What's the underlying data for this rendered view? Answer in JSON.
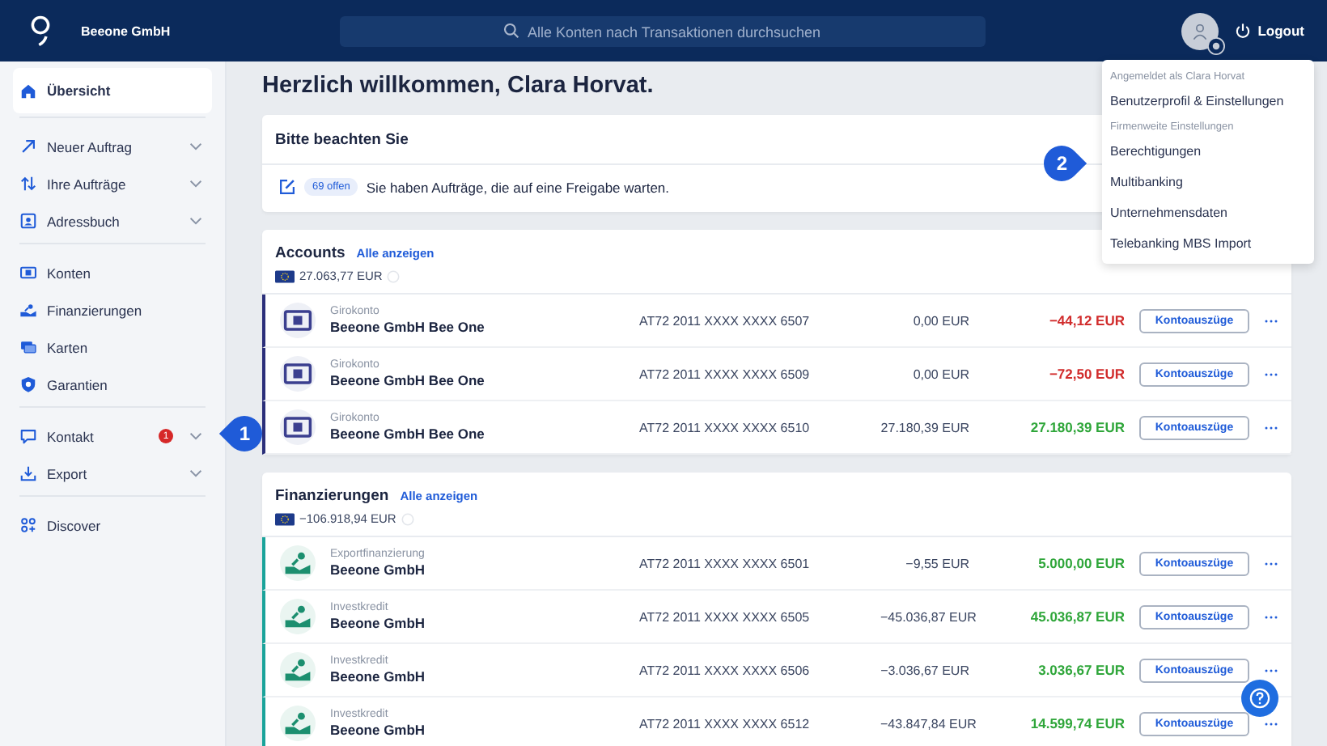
{
  "header": {
    "company": "Beeone GmbH",
    "search": {
      "placeholder": "Alle Konten nach Transaktionen durchsuchen"
    },
    "logout": "Logout"
  },
  "user_menu": [
    {
      "kind": "label",
      "text": "Angemeldet als Clara Horvat"
    },
    {
      "kind": "item",
      "text": "Benutzerprofil & Einstellungen"
    },
    {
      "kind": "label",
      "text": "Firmenweite Einstellungen"
    },
    {
      "kind": "item",
      "text": "Berechtigungen"
    },
    {
      "kind": "item",
      "text": "Multibanking"
    },
    {
      "kind": "item",
      "text": "Unternehmensdaten"
    },
    {
      "kind": "item",
      "text": "Telebanking MBS Import"
    }
  ],
  "sidebar": {
    "groups": [
      [
        {
          "label": "Übersicht",
          "selected": true,
          "expandable": false
        }
      ],
      [
        {
          "label": "Neuer Auftrag",
          "selected": false,
          "expandable": true
        },
        {
          "label": "Ihre Aufträge",
          "selected": false,
          "expandable": true
        },
        {
          "label": "Adressbuch",
          "selected": false,
          "expandable": true
        }
      ],
      [
        {
          "label": "Konten",
          "selected": false,
          "expandable": false
        },
        {
          "label": "Finanzierungen",
          "selected": false,
          "expandable": false
        },
        {
          "label": "Karten",
          "selected": false,
          "expandable": false
        },
        {
          "label": "Garantien",
          "selected": false,
          "expandable": false
        }
      ],
      [
        {
          "label": "Kontakt",
          "selected": false,
          "expandable": true,
          "badge": "1"
        },
        {
          "label": "Export",
          "selected": false,
          "expandable": true
        }
      ],
      [
        {
          "label": "Discover",
          "selected": false,
          "expandable": false
        }
      ]
    ]
  },
  "greeting": "Herzlich willkommen, Clara Horvat.",
  "notice": {
    "title": "Bitte beachten Sie",
    "badge": "69 offen",
    "text": "Sie haben Aufträge, die auf eine Freigabe warten."
  },
  "sections": [
    {
      "kind": "accounts",
      "title": "Accounts",
      "link": "Alle anzeigen",
      "total": "27.063,77 EUR",
      "rows": [
        {
          "type": "Girokonto",
          "name": "Beeone GmbH Bee One",
          "iban": "AT72 2011 XXXX XXXX 6507",
          "balance": "0,00 EUR",
          "available": "−44,12 EUR",
          "overdrawn": true,
          "button": "Kontoauszüge"
        },
        {
          "type": "Girokonto",
          "name": "Beeone GmbH Bee One",
          "iban": "AT72 2011 XXXX XXXX 6509",
          "balance": "0,00 EUR",
          "available": "−72,50 EUR",
          "overdrawn": true,
          "button": "Kontoauszüge"
        },
        {
          "type": "Girokonto",
          "name": "Beeone GmbH Bee One",
          "iban": "AT72 2011 XXXX XXXX 6510",
          "balance": "27.180,39 EUR",
          "available": "27.180,39 EUR",
          "overdrawn": false,
          "button": "Kontoauszüge"
        }
      ]
    },
    {
      "kind": "financing",
      "title": "Finanzierungen",
      "link": "Alle anzeigen",
      "total": "−106.918,94 EUR",
      "rows": [
        {
          "type": "Exportfinanzierung",
          "name": "Beeone GmbH",
          "iban": "AT72 2011 XXXX XXXX 6501",
          "balance": "−9,55 EUR",
          "available": "5.000,00 EUR",
          "overdrawn": false,
          "button": "Kontoauszüge"
        },
        {
          "type": "Investkredit",
          "name": "Beeone GmbH",
          "iban": "AT72 2011 XXXX XXXX 6505",
          "balance": "−45.036,87 EUR",
          "available": "45.036,87 EUR",
          "overdrawn": false,
          "button": "Kontoauszüge"
        },
        {
          "type": "Investkredit",
          "name": "Beeone GmbH",
          "iban": "AT72 2011 XXXX XXXX 6506",
          "balance": "−3.036,67 EUR",
          "available": "3.036,67 EUR",
          "overdrawn": false,
          "button": "Kontoauszüge"
        },
        {
          "type": "Investkredit",
          "name": "Beeone GmbH",
          "iban": "AT72 2011 XXXX XXXX 6512",
          "balance": "−43.847,84 EUR",
          "available": "14.599,74 EUR",
          "overdrawn": false,
          "button": "Kontoauszüge"
        }
      ]
    }
  ],
  "callouts": [
    {
      "label": "1"
    },
    {
      "label": "2"
    }
  ]
}
